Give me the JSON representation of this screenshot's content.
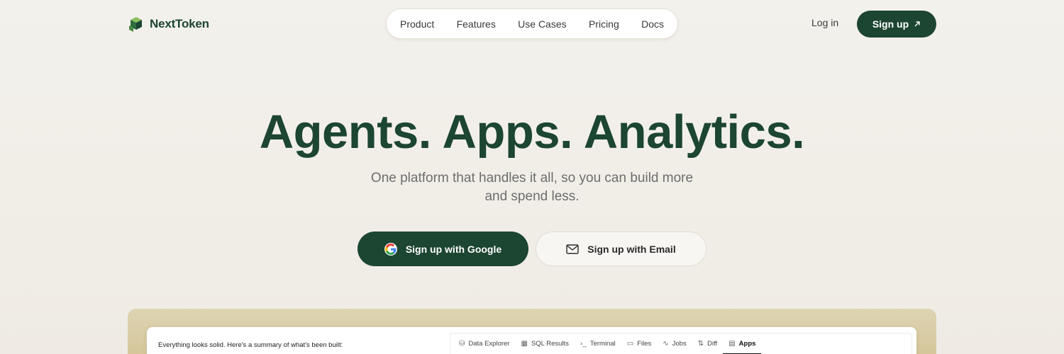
{
  "brand": {
    "name": "NextToken",
    "accent": "#1c4532"
  },
  "nav": {
    "items": [
      "Product",
      "Features",
      "Use Cases",
      "Pricing",
      "Docs"
    ]
  },
  "auth": {
    "login_label": "Log in",
    "signup_label": "Sign up",
    "signup_icon": "arrow-up-right-icon"
  },
  "hero": {
    "title": "Agents. Apps. Analytics.",
    "subtitle_line1": "One platform that handles it all, so you can build more",
    "subtitle_line2": "and spend less.",
    "google_button": "Sign up with Google",
    "email_button": "Sign up with Email"
  },
  "preview": {
    "chat_message": "Everything looks solid. Here's a summary of what's been built:",
    "tabs": [
      {
        "label": "Data Explorer",
        "icon": "database-icon"
      },
      {
        "label": "SQL Results",
        "icon": "table-icon"
      },
      {
        "label": "Terminal",
        "icon": "terminal-icon"
      },
      {
        "label": "Files",
        "icon": "folder-icon"
      },
      {
        "label": "Jobs",
        "icon": "activity-icon"
      },
      {
        "label": "Diff",
        "icon": "diff-icon"
      },
      {
        "label": "Apps",
        "icon": "app-icon",
        "active": true
      }
    ]
  }
}
